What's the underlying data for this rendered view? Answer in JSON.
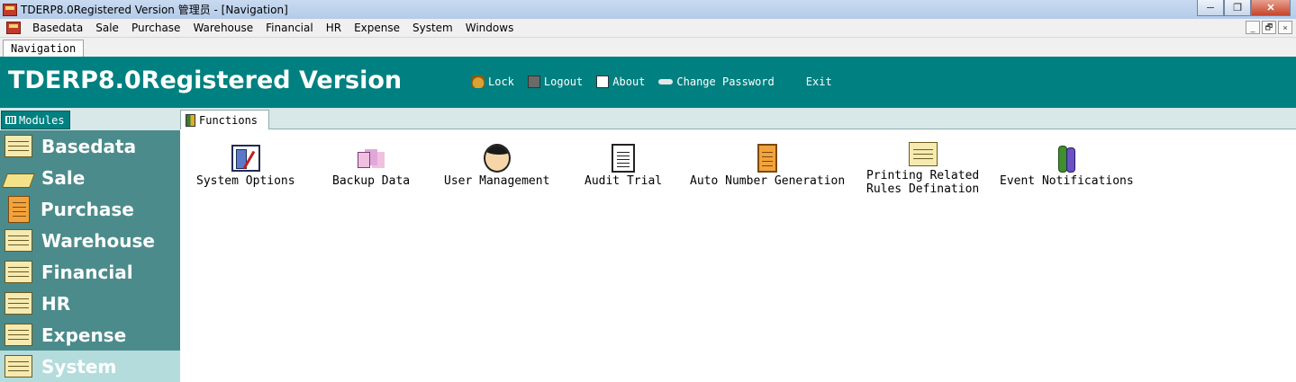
{
  "window": {
    "title": "TDERP8.0Registered Version 管理员 - [Navigation]",
    "minimize_glyph": "─",
    "maximize_glyph": "❐",
    "close_glyph": "✕",
    "icon": "app-logo-icon"
  },
  "menubar": {
    "items": [
      "Basedata",
      "Sale",
      "Purchase",
      "Warehouse",
      "Financial",
      "HR",
      "Expense",
      "System",
      "Windows"
    ],
    "mdi_minimize": "_",
    "mdi_restore": "🗗",
    "mdi_close": "×"
  },
  "doc_tabs": {
    "active": "Navigation"
  },
  "header": {
    "app_title": "TDERP8.0Registered Version",
    "toolbar": [
      {
        "label": "Lock",
        "icon": "lock-icon"
      },
      {
        "label": "Logout",
        "icon": "logout-icon"
      },
      {
        "label": "About",
        "icon": "about-icon"
      },
      {
        "label": "Change Password",
        "icon": "key-icon"
      },
      {
        "label": "Exit",
        "icon": ""
      }
    ],
    "colors": {
      "header_bg": "#008080",
      "text": "#ffffff"
    }
  },
  "sidebar": {
    "tab_label": "Modules",
    "items": [
      {
        "label": "Basedata",
        "icon": "folder-icon"
      },
      {
        "label": "Sale",
        "icon": "book-icon"
      },
      {
        "label": "Purchase",
        "icon": "notebook-icon"
      },
      {
        "label": "Warehouse",
        "icon": "folder-icon"
      },
      {
        "label": "Financial",
        "icon": "folder-icon"
      },
      {
        "label": "HR",
        "icon": "folder-icon"
      },
      {
        "label": "Expense",
        "icon": "folder-icon"
      },
      {
        "label": "System",
        "icon": "folder-icon",
        "selected": true
      }
    ],
    "colors": {
      "item_bg": "#4b8b8b",
      "selected_bg": "#b4dcdc"
    }
  },
  "main": {
    "tab_label": "Functions",
    "functions": [
      {
        "label": "System Options",
        "icon": "settings-window-icon"
      },
      {
        "label": "Backup Data",
        "icon": "backup-icon"
      },
      {
        "label": "User Management",
        "icon": "user-icon"
      },
      {
        "label": "Audit Trial",
        "icon": "audit-document-icon"
      },
      {
        "label": "Auto Number Generation",
        "icon": "numbering-notebook-icon"
      },
      {
        "label": "Printing Related\nRules Defination",
        "icon": "print-rules-icon"
      },
      {
        "label": "Event Notifications",
        "icon": "event-notification-icon"
      }
    ]
  }
}
